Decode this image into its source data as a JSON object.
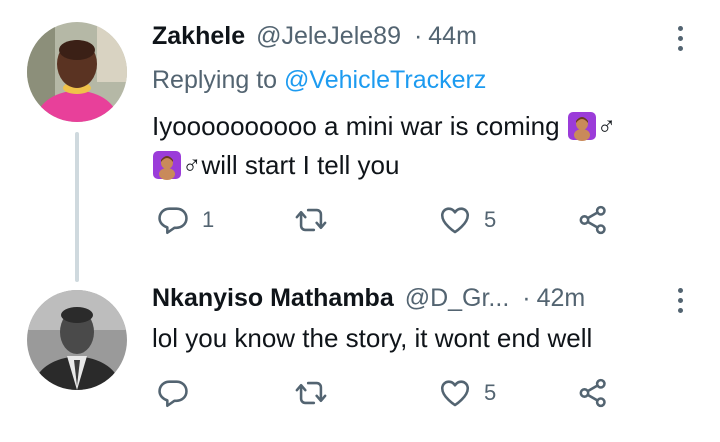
{
  "tweets": [
    {
      "author_name": "Zakhele",
      "handle": "@JeleJele89",
      "separator": "·",
      "time": "44m",
      "replying_prefix": "Replying to",
      "replying_to": "@VehicleTrackerz",
      "text_line1": "Iyoooooooooo a mini war is coming",
      "text_line1_tail": "♂",
      "text_line2": "♂will start I tell you",
      "reply_count": "1",
      "retweet_count": "",
      "like_count": "5",
      "icons": {
        "reply": "reply-icon",
        "retweet": "retweet-icon",
        "like": "heart-icon",
        "share": "share-icon",
        "emoji": "woman-gesturing-ok-emoji"
      }
    },
    {
      "author_name": "Nkanyiso Mathamba",
      "handle": "@D_Gr...",
      "separator": "·",
      "time": "42m",
      "text_line1": "lol you know the story, it wont end well",
      "reply_count": "",
      "retweet_count": "",
      "like_count": "5"
    }
  ],
  "colors": {
    "text": "#0f1419",
    "secondary": "#536471",
    "link": "#1d9bf0",
    "thread_line": "#cfd9de",
    "emoji_bg": "#9b3cd9"
  }
}
